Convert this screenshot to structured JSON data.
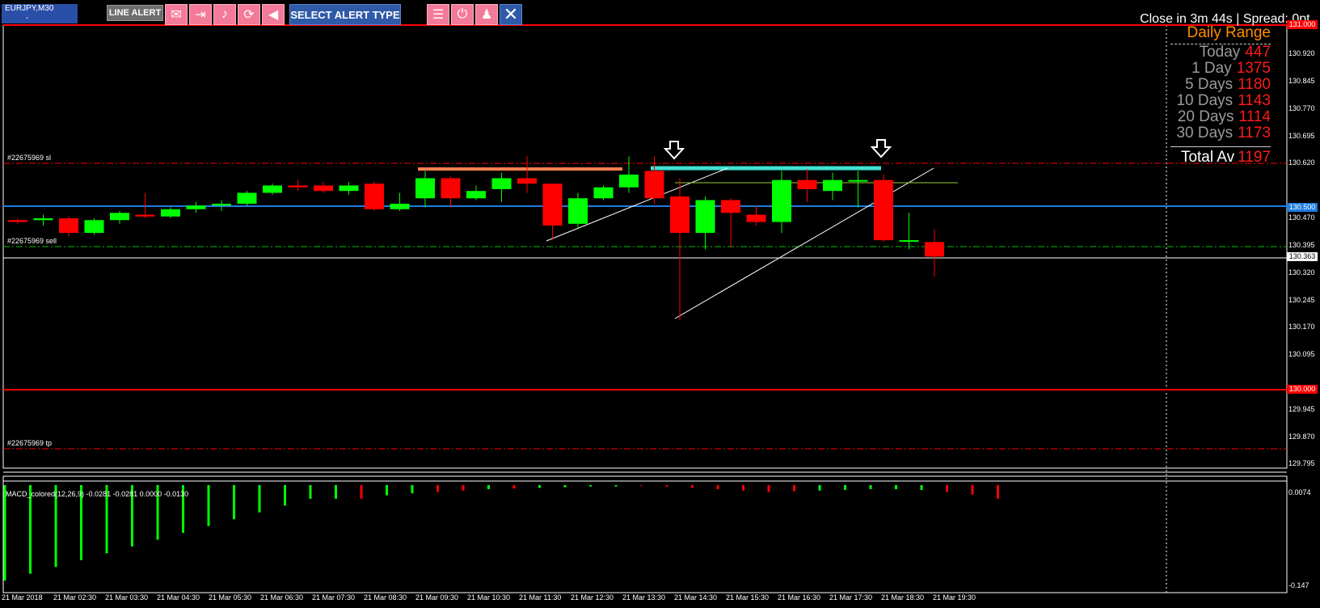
{
  "toolbar": {
    "symbol": "EURJPY,M30",
    "symbol_value": "-",
    "line_alert": "LINE ALERT",
    "select_alert_type": "SELECT ALERT TYPE",
    "icons": [
      "mail-icon",
      "export-icon",
      "music-note-icon",
      "refresh-icon",
      "speaker-icon",
      "list-icon",
      "power-icon",
      "user-icon",
      "close-icon"
    ]
  },
  "status_text": "Close in 3m 44s | Spread: 0pt.",
  "daily_range": {
    "title": "Daily Range",
    "rows": [
      {
        "label": "Today",
        "value": "447"
      },
      {
        "label": "1 Day",
        "value": "1375"
      },
      {
        "label": "5 Days",
        "value": "1180"
      },
      {
        "label": "10 Days",
        "value": "1143"
      },
      {
        "label": "20 Days",
        "value": "1114"
      },
      {
        "label": "30 Days",
        "value": "1173"
      }
    ],
    "total_label": "Total Av",
    "total_value": "1197"
  },
  "order_labels": {
    "sl": "#22675969 sl",
    "sell": "#22675969 sell",
    "tp": "#22675969 tp"
  },
  "price_axis": [
    "130.920",
    "130.845",
    "130.770",
    "130.695",
    "130.620",
    "130.470",
    "130.395",
    "130.320",
    "130.245",
    "130.170",
    "130.095",
    "129.945",
    "129.870",
    "129.795"
  ],
  "price_tags": [
    {
      "value": "131.000",
      "color": "#ff0000"
    },
    {
      "value": "130.500",
      "color": "#1f7be0"
    },
    {
      "value": "130.363",
      "color": "#ffffff"
    },
    {
      "value": "130.000",
      "color": "#ff0000"
    }
  ],
  "macd": {
    "title": "MACD_colored(12,26,9) -0.0281 -0.0281 0.0000 -0.0130",
    "axis_top": "0.0074",
    "axis_bottom": "-0.147",
    "bars": [
      -0.14,
      -0.13,
      -0.12,
      -0.11,
      -0.1,
      -0.09,
      -0.08,
      -0.07,
      -0.06,
      -0.05,
      -0.04,
      -0.03,
      -0.02,
      -0.02,
      -0.02,
      -0.015,
      -0.012,
      -0.01,
      -0.008,
      -0.006,
      -0.005,
      -0.004,
      -0.003,
      -0.002,
      -0.002,
      -0.001,
      -0.002,
      -0.004,
      -0.006,
      -0.008,
      -0.01,
      -0.009,
      -0.008,
      -0.007,
      -0.006,
      -0.006,
      -0.007,
      -0.01,
      -0.014,
      -0.02
    ],
    "bar_colors": [
      "g",
      "g",
      "g",
      "g",
      "g",
      "g",
      "g",
      "g",
      "g",
      "g",
      "g",
      "g",
      "g",
      "g",
      "r",
      "g",
      "g",
      "r",
      "r",
      "g",
      "r",
      "g",
      "g",
      "g",
      "g",
      "r",
      "r",
      "r",
      "r",
      "r",
      "r",
      "r",
      "g",
      "g",
      "g",
      "g",
      "g",
      "r",
      "r",
      "r"
    ]
  },
  "time_axis": [
    "21 Mar 2018",
    "21 Mar 02:30",
    "21 Mar 03:30",
    "21 Mar 04:30",
    "21 Mar 05:30",
    "21 Mar 06:30",
    "21 Mar 07:30",
    "21 Mar 08:30",
    "21 Mar 09:30",
    "21 Mar 10:30",
    "21 Mar 11:30",
    "21 Mar 12:30",
    "21 Mar 13:30",
    "21 Mar 14:30",
    "21 Mar 15:30",
    "21 Mar 16:30",
    "21 Mar 17:30",
    "21 Mar 18:30",
    "21 Mar 19:30"
  ],
  "candles": [
    {
      "o": 130.465,
      "h": 130.47,
      "l": 130.455,
      "c": 130.46
    },
    {
      "o": 130.465,
      "h": 130.48,
      "l": 130.45,
      "c": 130.47
    },
    {
      "o": 130.47,
      "h": 130.475,
      "l": 130.42,
      "c": 130.43
    },
    {
      "o": 130.43,
      "h": 130.47,
      "l": 130.425,
      "c": 130.465
    },
    {
      "o": 130.465,
      "h": 130.49,
      "l": 130.455,
      "c": 130.485
    },
    {
      "o": 130.48,
      "h": 130.54,
      "l": 130.47,
      "c": 130.475
    },
    {
      "o": 130.475,
      "h": 130.5,
      "l": 130.47,
      "c": 130.495
    },
    {
      "o": 130.495,
      "h": 130.515,
      "l": 130.485,
      "c": 130.505
    },
    {
      "o": 130.505,
      "h": 130.52,
      "l": 130.49,
      "c": 130.51
    },
    {
      "o": 130.51,
      "h": 130.545,
      "l": 130.505,
      "c": 130.54
    },
    {
      "o": 130.54,
      "h": 130.565,
      "l": 130.535,
      "c": 130.56
    },
    {
      "o": 130.56,
      "h": 130.575,
      "l": 130.545,
      "c": 130.555
    },
    {
      "o": 130.56,
      "h": 130.57,
      "l": 130.54,
      "c": 130.545
    },
    {
      "o": 130.545,
      "h": 130.57,
      "l": 130.535,
      "c": 130.56
    },
    {
      "o": 130.565,
      "h": 130.57,
      "l": 130.49,
      "c": 130.495
    },
    {
      "o": 130.495,
      "h": 130.54,
      "l": 130.49,
      "c": 130.51
    },
    {
      "o": 130.525,
      "h": 130.6,
      "l": 130.5,
      "c": 130.58
    },
    {
      "o": 130.58,
      "h": 130.585,
      "l": 130.5,
      "c": 130.525
    },
    {
      "o": 130.525,
      "h": 130.56,
      "l": 130.52,
      "c": 130.545
    },
    {
      "o": 130.55,
      "h": 130.595,
      "l": 130.515,
      "c": 130.58
    },
    {
      "o": 130.58,
      "h": 130.64,
      "l": 130.54,
      "c": 130.565
    },
    {
      "o": 130.565,
      "h": 130.56,
      "l": 130.41,
      "c": 130.45
    },
    {
      "o": 130.455,
      "h": 130.54,
      "l": 130.44,
      "c": 130.525
    },
    {
      "o": 130.525,
      "h": 130.56,
      "l": 130.52,
      "c": 130.555
    },
    {
      "o": 130.555,
      "h": 130.64,
      "l": 130.54,
      "c": 130.59
    },
    {
      "o": 130.6,
      "h": 130.64,
      "l": 130.51,
      "c": 130.525
    },
    {
      "o": 130.53,
      "h": 130.58,
      "l": 130.19,
      "c": 130.43
    },
    {
      "o": 130.43,
      "h": 130.53,
      "l": 130.385,
      "c": 130.52
    },
    {
      "o": 130.52,
      "h": 130.525,
      "l": 130.39,
      "c": 130.485
    },
    {
      "o": 130.48,
      "h": 130.505,
      "l": 130.45,
      "c": 130.46
    },
    {
      "o": 130.46,
      "h": 130.6,
      "l": 130.43,
      "c": 130.575
    },
    {
      "o": 130.575,
      "h": 130.605,
      "l": 130.515,
      "c": 130.55
    },
    {
      "o": 130.545,
      "h": 130.595,
      "l": 130.52,
      "c": 130.575
    },
    {
      "o": 130.575,
      "h": 130.6,
      "l": 130.5,
      "c": 130.575
    },
    {
      "o": 130.575,
      "h": 130.59,
      "l": 130.405,
      "c": 130.41
    },
    {
      "o": 130.41,
      "h": 130.485,
      "l": 130.385,
      "c": 130.41
    },
    {
      "o": 130.405,
      "h": 130.44,
      "l": 130.31,
      "c": 130.365
    }
  ]
}
